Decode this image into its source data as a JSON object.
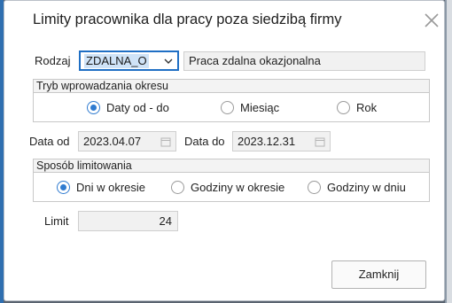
{
  "dialog": {
    "title": "Limity pracownika dla pracy poza siedzibą firmy",
    "close_icon": "close-icon"
  },
  "rodzaj": {
    "label": "Rodzaj",
    "value": "ZDALNA_O",
    "description": "Praca zdalna okazjonalna"
  },
  "tryb": {
    "header": "Tryb wprowadzania okresu",
    "options": [
      "Daty od - do",
      "Miesiąc",
      "Rok"
    ],
    "selected": "Daty od - do"
  },
  "dates": {
    "from_label": "Data od",
    "from_value": "2023.04.07",
    "to_label": "Data do",
    "to_value": "2023.12.31"
  },
  "sposob": {
    "header": "Sposób limitowania",
    "options": [
      "Dni w okresie",
      "Godziny w okresie",
      "Godziny w dniu"
    ],
    "selected": "Dni w okresie"
  },
  "limit": {
    "label": "Limit",
    "value": "24"
  },
  "buttons": {
    "close_label": "Zamknij"
  },
  "colors": {
    "accent": "#1f6fc4",
    "radio_selected": "#2f7bd0",
    "field_bg": "#f1f1f1"
  }
}
